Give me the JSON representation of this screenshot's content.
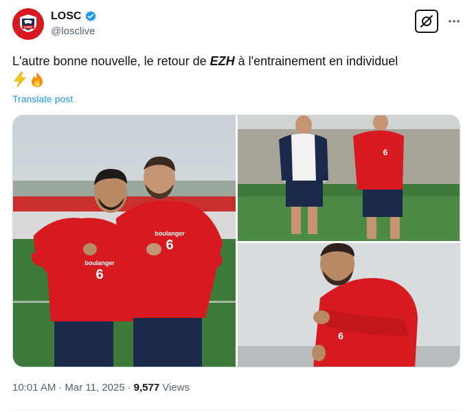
{
  "author": {
    "display_name": "LOSC",
    "handle": "@losclive",
    "verified": true,
    "avatar_text": "LOSC"
  },
  "tweet": {
    "text_before": "L'autre bonne nouvelle, le retour de ",
    "text_emphasis": "EZH",
    "text_after": " à l'entrainement en individuel",
    "emojis": [
      "⚡",
      "🔥"
    ],
    "translate_label": "Translate post"
  },
  "media": {
    "sponsor_text": "boulanger",
    "shirt_number": "6"
  },
  "meta": {
    "time": "10:01 AM",
    "separator": "·",
    "date": "Mar 11, 2025",
    "views_count": "9,577",
    "views_label": "Views"
  },
  "icons": {
    "grok": "grok-icon",
    "more": "more-icon",
    "verified": "verified-badge-icon"
  },
  "colors": {
    "brand_red": "#d71920",
    "link_blue": "#1d9bf0",
    "secondary_text": "#536471"
  }
}
